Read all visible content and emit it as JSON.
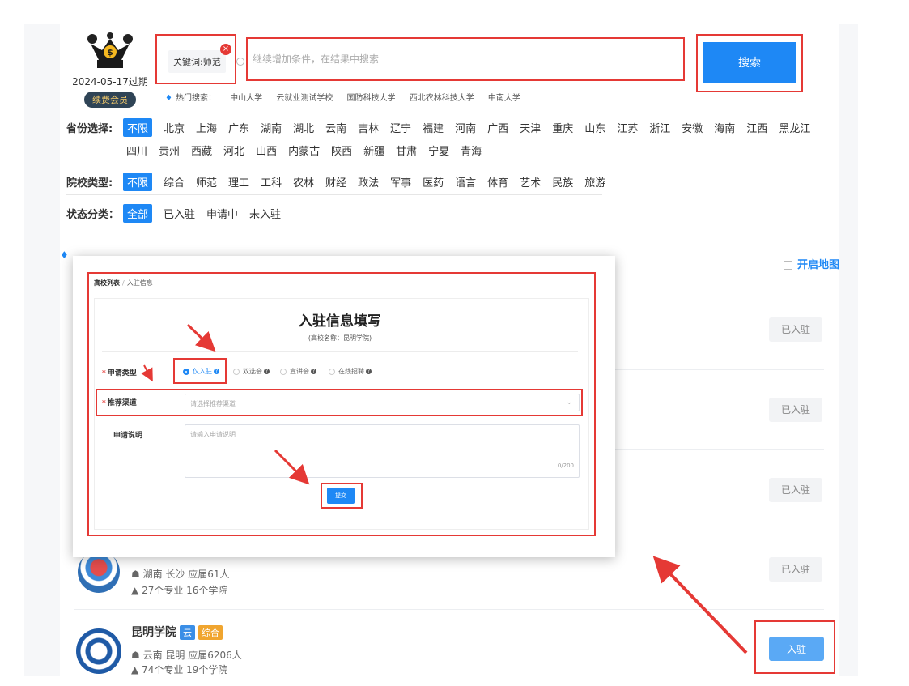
{
  "member": {
    "expiry": "2024-05-17过期",
    "renew_label": "续费会员"
  },
  "search": {
    "keyword_chip": "关键词:师范",
    "placeholder": "继续增加条件，在结果中搜索",
    "button_label": "搜索"
  },
  "hot_search": {
    "label": "热门搜索：",
    "items": [
      "中山大学",
      "云就业测试学校",
      "国防科技大学",
      "西北农林科技大学",
      "中南大学"
    ]
  },
  "filters": {
    "province_label": "省份选择:",
    "provinces_line1": [
      "不限",
      "北京",
      "上海",
      "广东",
      "湖南",
      "湖北",
      "云南",
      "吉林",
      "辽宁",
      "福建",
      "河南",
      "广西",
      "天津",
      "重庆",
      "山东",
      "江苏",
      "浙江",
      "安徽",
      "海南",
      "江西",
      "黑龙江"
    ],
    "provinces_line2": [
      "四川",
      "贵州",
      "西藏",
      "河北",
      "山西",
      "内蒙古",
      "陕西",
      "新疆",
      "甘肃",
      "宁夏",
      "青海"
    ],
    "type_label": "院校类型:",
    "types": [
      "不限",
      "综合",
      "师范",
      "理工",
      "工科",
      "农林",
      "财经",
      "政法",
      "军事",
      "医药",
      "语言",
      "体育",
      "艺术",
      "民族",
      "旅游"
    ],
    "status_label": "状态分类：",
    "statuses": [
      "全部",
      "已入驻",
      "申请中",
      "未入驻"
    ]
  },
  "open_map": "开启地图",
  "list": {
    "status_joined": "已入驻",
    "row4": {
      "location": "湖南 长沙  应届61人",
      "stats": "27个专业  16个学院"
    },
    "row5": {
      "name": "昆明学院",
      "tag1": "云",
      "tag2": "综合",
      "location": "云南 昆明  应届6206人",
      "stats": "74个专业  19个学院",
      "join_label": "入驻"
    }
  },
  "modal": {
    "crumb_root": "高校列表",
    "crumb_current": "入驻信息",
    "title": "入驻信息填写",
    "subtitle": "(高校名称：昆明学院)",
    "apply_type_label": "申请类型",
    "apply_options": [
      "仅入驻",
      "双选会",
      "宣讲会",
      "在线招聘"
    ],
    "channel_label": "推荐渠道",
    "channel_placeholder": "请选择推荐渠道",
    "desc_label": "申请说明",
    "desc_placeholder": "请输入申请说明",
    "desc_count": "0/200",
    "submit_label": "提交"
  },
  "colors": {
    "accent": "#1e88f5",
    "annotation": "#e53935",
    "tag_orange": "#f0a52f"
  }
}
